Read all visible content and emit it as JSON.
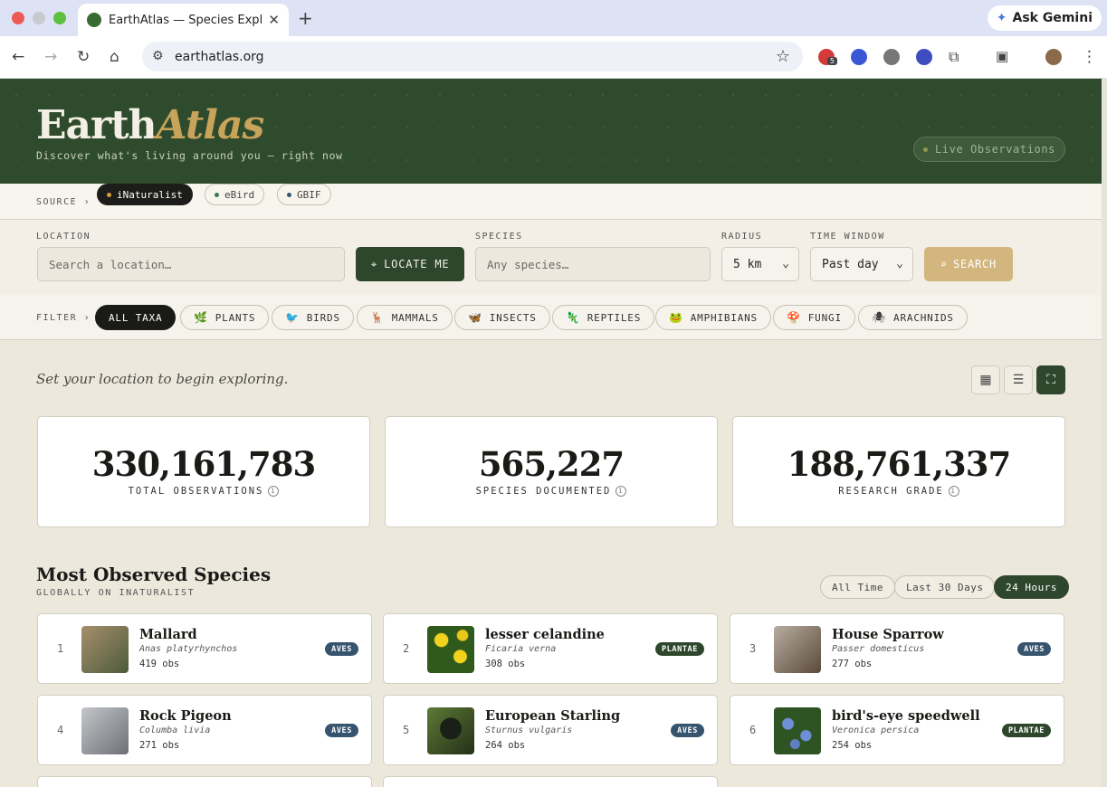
{
  "browser": {
    "tab_title": "EarthAtlas — Species Explorer",
    "url": "earthatlas.org",
    "gemini_label": "Ask Gemini",
    "ext_badge": "5"
  },
  "hero": {
    "logo_part1": "Earth",
    "logo_part2": "Atlas",
    "tagline": "Discover what's living around you — right now",
    "live_label": "Live Observations"
  },
  "source": {
    "label": "SOURCE ›",
    "options": [
      {
        "label": "iNaturalist",
        "active": true,
        "dot": "#d89a3a"
      },
      {
        "label": "eBird",
        "active": false,
        "dot": "#3b7a55"
      },
      {
        "label": "GBIF",
        "active": false,
        "dot": "#37546f"
      }
    ]
  },
  "form": {
    "location_label": "LOCATION",
    "location_placeholder": "Search a location…",
    "locate_label": "LOCATE ME",
    "species_label": "SPECIES",
    "species_placeholder": "Any species…",
    "radius_label": "RADIUS",
    "radius_value": "5 km",
    "time_label": "TIME WINDOW",
    "time_value": "Past day",
    "search_label": "SEARCH"
  },
  "filter": {
    "label": "FILTER ›",
    "chips": [
      {
        "label": "ALL TAXA",
        "icon": "",
        "active": true
      },
      {
        "label": "PLANTS",
        "icon": "🌿",
        "active": false
      },
      {
        "label": "BIRDS",
        "icon": "🐦",
        "active": false
      },
      {
        "label": "MAMMALS",
        "icon": "🦌",
        "active": false
      },
      {
        "label": "INSECTS",
        "icon": "🦋",
        "active": false
      },
      {
        "label": "REPTILES",
        "icon": "🦎",
        "active": false
      },
      {
        "label": "AMPHIBIANS",
        "icon": "🐸",
        "active": false
      },
      {
        "label": "FUNGI",
        "icon": "🍄",
        "active": false
      },
      {
        "label": "ARACHNIDS",
        "icon": "🕷",
        "active": false
      }
    ]
  },
  "main": {
    "hint": "Set your location to begin exploring.",
    "stats": [
      {
        "value": "330,161,783",
        "caption": "TOTAL OBSERVATIONS"
      },
      {
        "value": "565,227",
        "caption": "SPECIES DOCUMENTED"
      },
      {
        "value": "188,761,337",
        "caption": "RESEARCH GRADE"
      }
    ],
    "section_title": "Most Observed Species",
    "section_subtitle": "GLOBALLY ON INATURALIST",
    "ranges": [
      {
        "label": "All Time",
        "active": false
      },
      {
        "label": "Last 30 Days",
        "active": false
      },
      {
        "label": "24 Hours",
        "active": true
      }
    ],
    "species": [
      {
        "rank": "1",
        "name": "Mallard",
        "sci": "Anas platyrhynchos",
        "obs": "419 obs",
        "badge": "AVES",
        "thumb": "#8a7a5e"
      },
      {
        "rank": "2",
        "name": "lesser celandine",
        "sci": "Ficaria verna",
        "obs": "308 obs",
        "badge": "PLANTAE",
        "thumb": "#3d6a1f"
      },
      {
        "rank": "3",
        "name": "House Sparrow",
        "sci": "Passer domesticus",
        "obs": "277 obs",
        "badge": "AVES",
        "thumb": "#7a6f62"
      },
      {
        "rank": "4",
        "name": "Rock Pigeon",
        "sci": "Columba livia",
        "obs": "271 obs",
        "badge": "AVES",
        "thumb": "#8f9297"
      },
      {
        "rank": "5",
        "name": "European Starling",
        "sci": "Sturnus vulgaris",
        "obs": "264 obs",
        "badge": "AVES",
        "thumb": "#2e3a22"
      },
      {
        "rank": "6",
        "name": "bird's-eye speedwell",
        "sci": "Veronica persica",
        "obs": "254 obs",
        "badge": "PLANTAE",
        "thumb": "#4f6fa0"
      }
    ]
  },
  "colors": {
    "hero_green": "#2f4b2d",
    "accent_gold": "#c8a35a",
    "aves_badge": "#37546f",
    "plantae_badge": "#2e472c"
  }
}
